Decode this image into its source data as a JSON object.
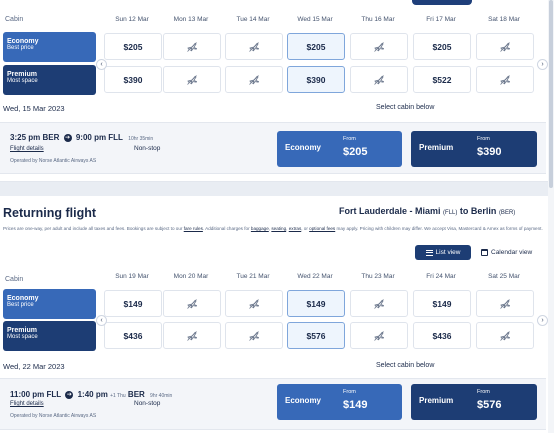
{
  "outbound": {
    "cabin_header": "Cabin",
    "days": [
      "Sun 12 Mar",
      "Mon 13 Mar",
      "Tue 14 Mar",
      "Wed 15 Mar",
      "Thu 16 Mar",
      "Fri 17 Mar",
      "Sat 18 Mar"
    ],
    "economy": {
      "title": "Economy",
      "subtitle": "Best price",
      "prices": [
        "$205",
        "",
        "",
        "$205",
        "",
        "$205",
        ""
      ]
    },
    "premium": {
      "title": "Premium",
      "subtitle": "Most space",
      "prices": [
        "$390",
        "",
        "",
        "$390",
        "",
        "$522",
        ""
      ]
    },
    "selected_date": "Wed, 15 Mar 2023",
    "select_cabin": "Select cabin below",
    "flight": {
      "depart": "3:25 pm BER",
      "arrive": "9:00 pm FLL",
      "duration": "10hr 35min",
      "details_link": "Flight details",
      "stops": "Non-stop",
      "operator": "Operated by Norse Atlantic Airways AS",
      "economy": {
        "name": "Economy",
        "from": "From",
        "price": "$205"
      },
      "premium": {
        "name": "Premium",
        "from": "From",
        "price": "$390"
      }
    }
  },
  "returning": {
    "title": "Returning flight",
    "route": {
      "from_city": "Fort Lauderdale - Miami",
      "from_code": "(FLL)",
      "to_word": "to",
      "to_city": "Berlin",
      "to_code": "(BER)"
    },
    "fine_print_1": "Prices are one-way, per adult and include all taxes and fees. Bookings are subject to our ",
    "fine_fare_rules": "fare rules",
    "fine_print_2": ". Additional charges for ",
    "fine_baggage": "baggage",
    "fine_sep1": ", ",
    "fine_seating": "seating",
    "fine_sep2": ", ",
    "fine_extras": "extras",
    "fine_sep3": ", or ",
    "fine_optional": "optional fees",
    "fine_print_3": " may apply. Pricing with children may differ. We accept Visa, Mastercard & Amex as forms of payment.",
    "list_view": "List view",
    "calendar_view": "Calendar view",
    "cabin_header": "Cabin",
    "days": [
      "Sun 19 Mar",
      "Mon 20 Mar",
      "Tue 21 Mar",
      "Wed 22 Mar",
      "Thu 23 Mar",
      "Fri 24 Mar",
      "Sat 25 Mar"
    ],
    "economy": {
      "title": "Economy",
      "subtitle": "Best price",
      "prices": [
        "$149",
        "",
        "",
        "$149",
        "",
        "$149",
        ""
      ]
    },
    "premium": {
      "title": "Premium",
      "subtitle": "Most space",
      "prices": [
        "$436",
        "",
        "",
        "$576",
        "",
        "$436",
        ""
      ]
    },
    "selected_date": "Wed, 22 Mar 2023",
    "select_cabin": "Select cabin below",
    "flight": {
      "depart": "11:00 pm FLL",
      "arrive": "1:40 pm",
      "plus_day": "+1 Thu",
      "arrive_code": "BER",
      "duration": "9hr 40min",
      "details_link": "Flight details",
      "stops": "Non-stop",
      "operator": "Operated by Norse Atlantic Airways AS",
      "economy": {
        "name": "Economy",
        "from": "From",
        "price": "$149"
      },
      "premium": {
        "name": "Premium",
        "from": "From",
        "price": "$576"
      }
    }
  },
  "icons": {
    "no_flight": "plane-crossed-icon",
    "prev": "chevron-left-icon",
    "next": "chevron-right-icon",
    "list": "list-icon",
    "calendar": "calendar-icon",
    "arrow": "arrow-right-icon"
  },
  "colors": {
    "economy": "#3769b8",
    "premium": "#1d3d74",
    "selected_cell": "#eef5fd"
  }
}
